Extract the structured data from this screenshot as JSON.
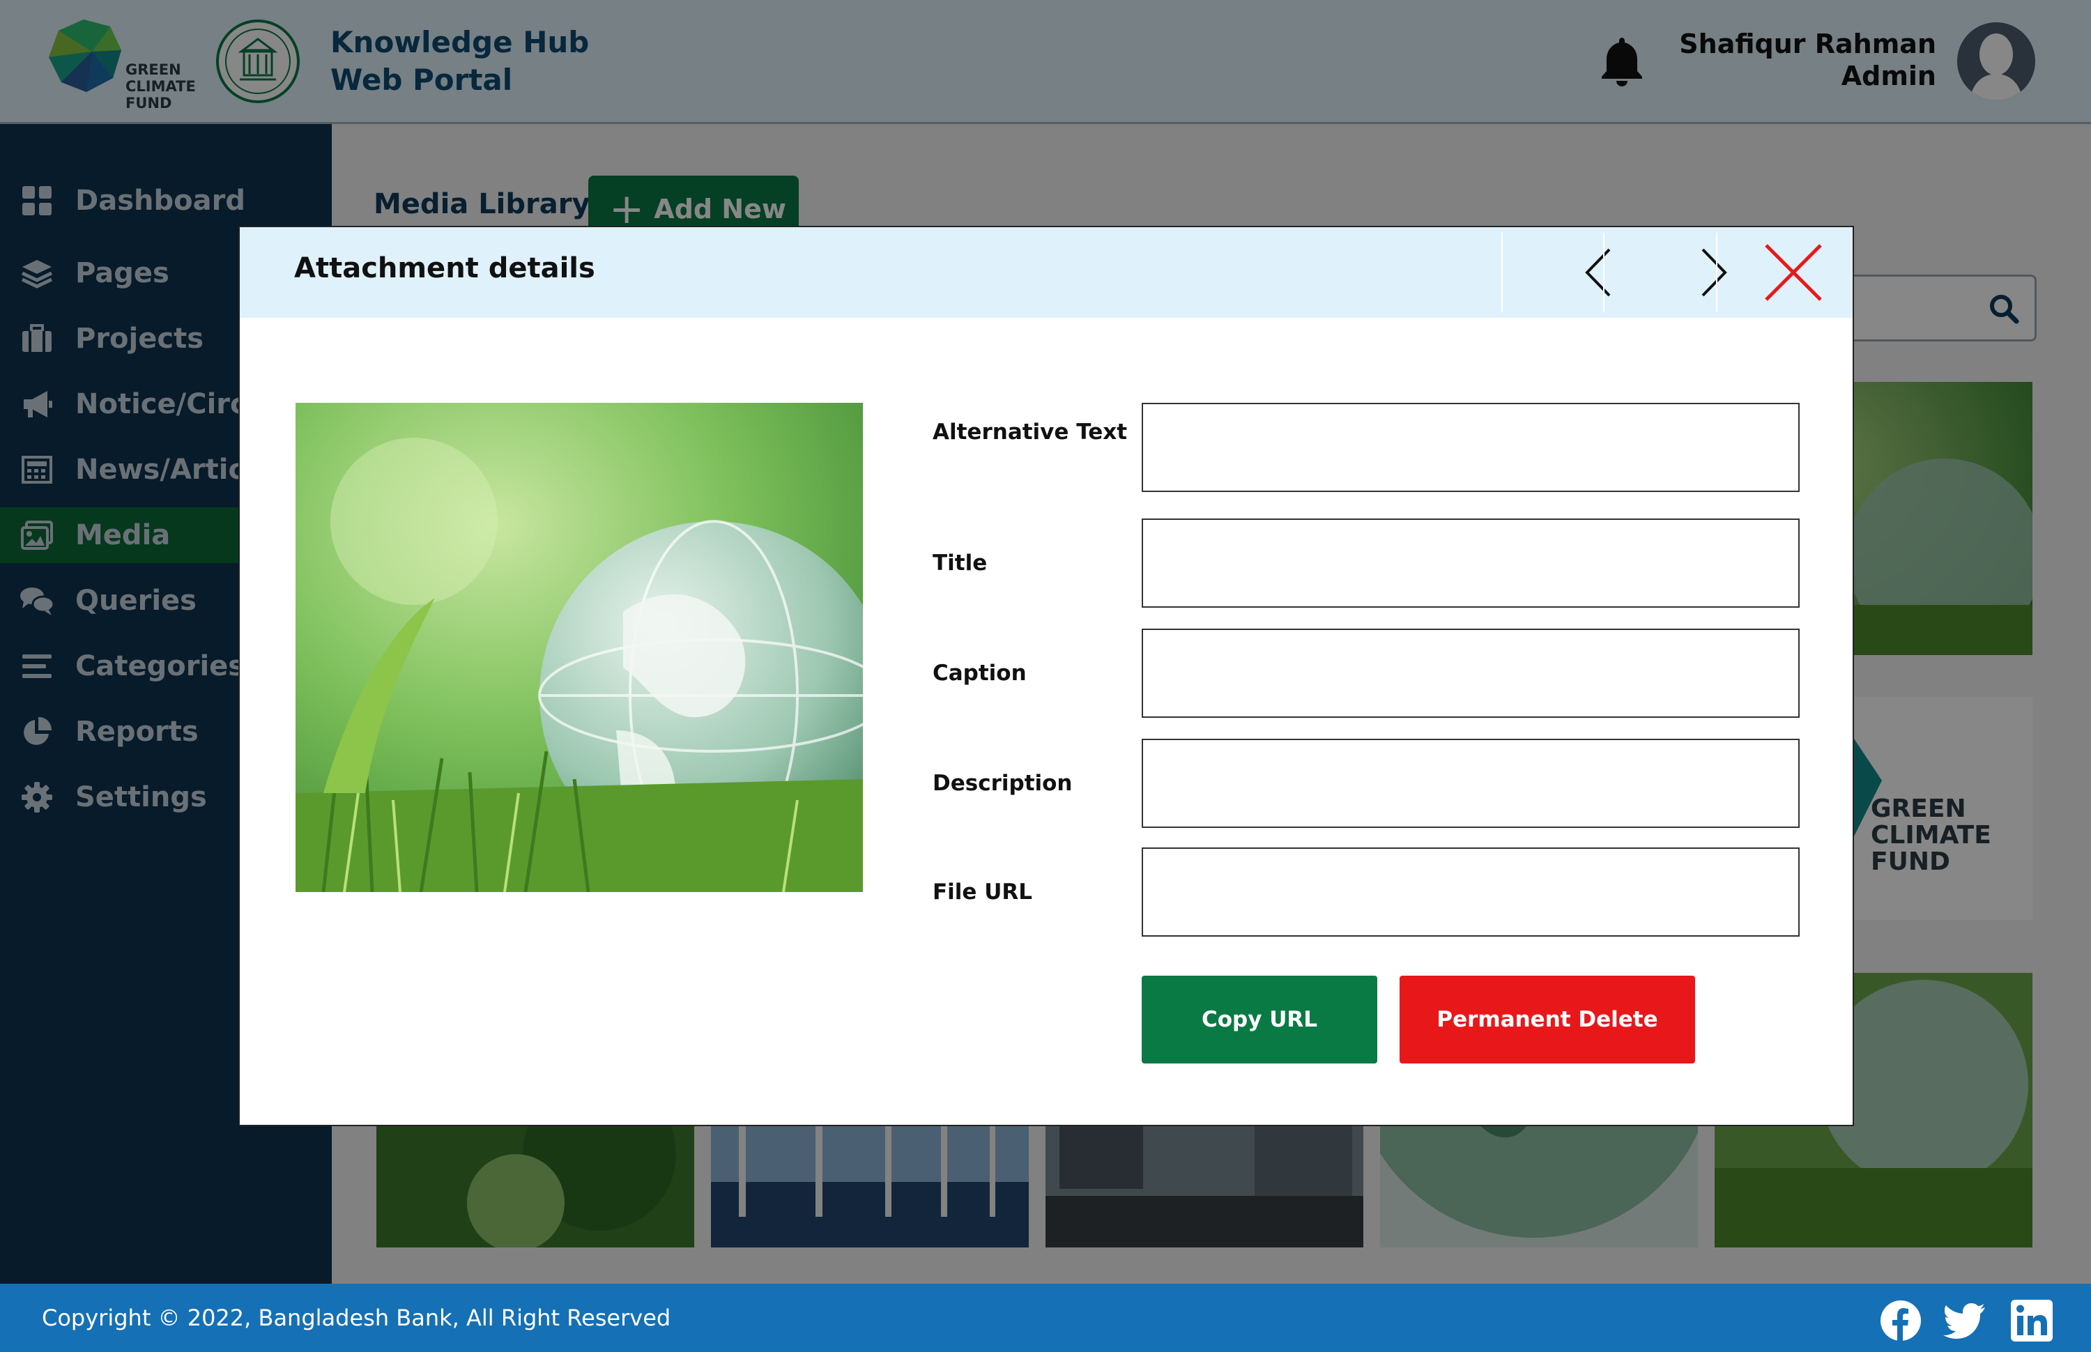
{
  "header": {
    "gcf_logo_text": [
      "GREEN",
      "CLIMATE",
      "FUND"
    ],
    "portal_title_line1": "Knowledge Hub",
    "portal_title_line2": "Web Portal",
    "user_name": "Shafiqur Rahman",
    "user_role": "Admin",
    "icons": [
      "gcf-logo-icon",
      "bangladesh-bank-logo-icon",
      "bell-icon",
      "avatar"
    ]
  },
  "sidebar": {
    "items": [
      {
        "label": "Dashboard",
        "icon": "grid-icon"
      },
      {
        "label": "Pages",
        "icon": "layers-icon"
      },
      {
        "label": "Projects",
        "icon": "briefcase-icon"
      },
      {
        "label": "Notice/Circu",
        "icon": "megaphone-icon"
      },
      {
        "label": "News/Articl",
        "icon": "newspaper-icon"
      },
      {
        "label": "Media",
        "icon": "image-icon",
        "active": true
      },
      {
        "label": "Queries",
        "icon": "chat-icon"
      },
      {
        "label": "Categories",
        "icon": "list-icon"
      },
      {
        "label": "Reports",
        "icon": "pie-chart-icon"
      },
      {
        "label": "Settings",
        "icon": "gear-icon"
      }
    ],
    "active_color": "#0d6b3a",
    "background": "#0f3350"
  },
  "content": {
    "page_title": "Media Library",
    "add_new_label": "Add New",
    "gcf_right_text": [
      "GREEN",
      "CLIMATE",
      "FUND"
    ]
  },
  "modal": {
    "title": "Attachment details",
    "fields": [
      {
        "label": "Alternative Text",
        "value": ""
      },
      {
        "label": "Title",
        "value": ""
      },
      {
        "label": "Caption",
        "value": ""
      },
      {
        "label": "Description",
        "value": ""
      },
      {
        "label": "File URL",
        "value": ""
      }
    ],
    "copy_url_label": "Copy URL",
    "delete_label": "Permanent Delete",
    "colors": {
      "primary": "#0a7a44",
      "danger": "#e8181a",
      "close": "#e8181a"
    }
  },
  "footer": {
    "copyright": "Copyright © 2022, Bangladesh Bank, All Right Reserved",
    "social": [
      "facebook-icon",
      "twitter-icon",
      "linkedin-icon"
    ]
  }
}
